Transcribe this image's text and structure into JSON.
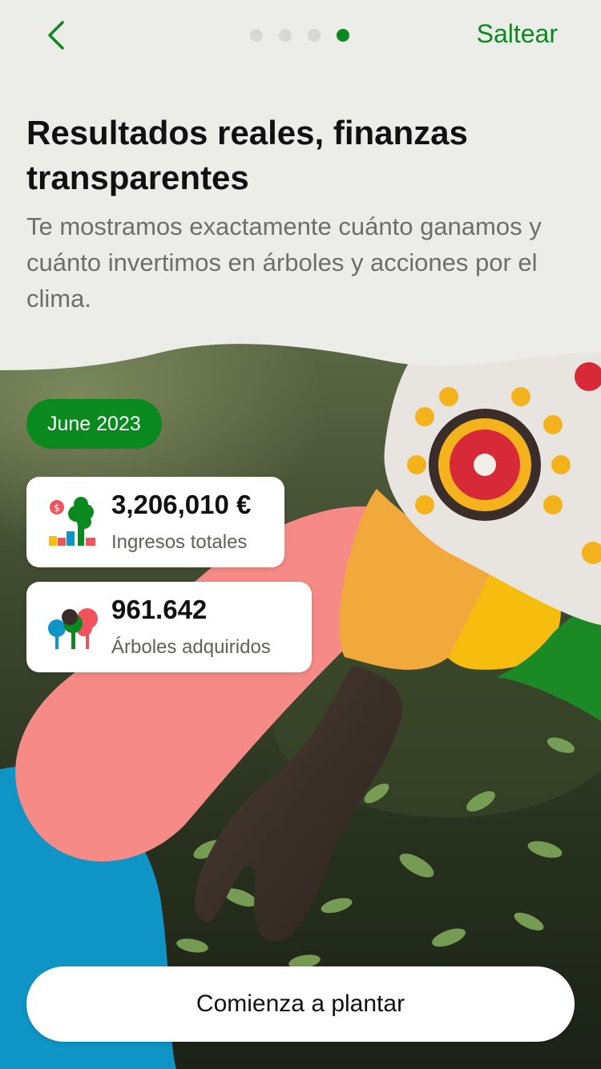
{
  "header": {
    "back_icon": "chevron-left-icon",
    "pager": {
      "count": 4,
      "active": 4
    },
    "skip_label": "Saltear"
  },
  "content": {
    "title": "Resultados reales, finanzas transparentes",
    "subtitle": "Te mostramos exactamente cuánto ganamos y cuánto invertimos en árboles y acciones por el clima."
  },
  "report": {
    "month": "June 2023",
    "stats": [
      {
        "icon": "finance-tree-icon",
        "value": "3,206,010 €",
        "label": "Ingresos totales"
      },
      {
        "icon": "trees-icon",
        "value": "961.642",
        "label": "Árboles adquiridos"
      }
    ]
  },
  "cta_label": "Comienza a plantar",
  "colors": {
    "accent_green": "#0a8a1e",
    "background": "#ecede8",
    "pink": "#f58a86",
    "blue": "#0e95c6",
    "yellow": "#f6bd0e",
    "green_shape": "#1b8a25"
  }
}
